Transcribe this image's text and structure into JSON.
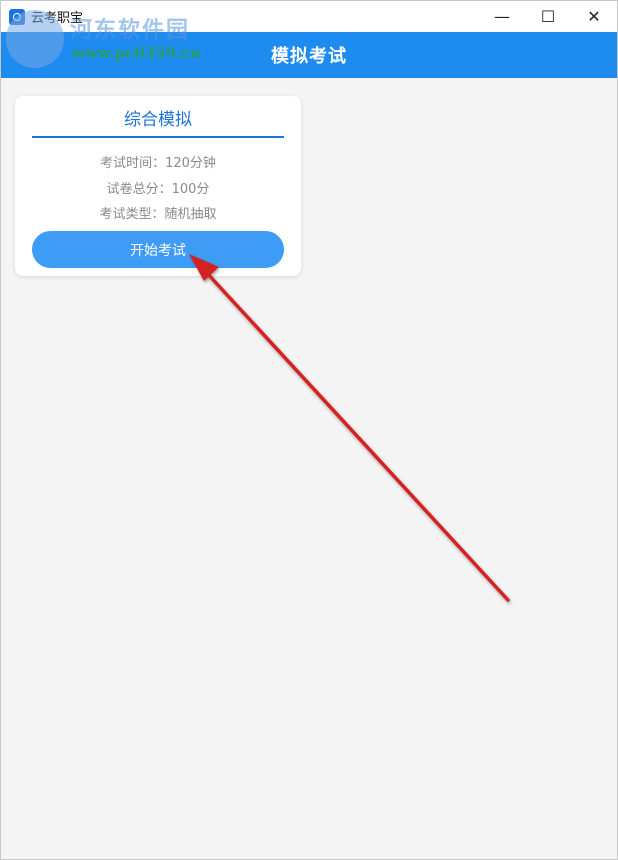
{
  "window": {
    "title": "云考职宝",
    "controls": {
      "minimize": "—",
      "maximize": "☐",
      "close": "✕"
    }
  },
  "watermark": {
    "line1": "河东软件园",
    "line2": "www.pc0359.cn"
  },
  "header": {
    "title": "模拟考试"
  },
  "card": {
    "title": "综合模拟",
    "exam_time": "考试时间：120分钟",
    "total_score": "试卷总分：100分",
    "exam_type": "考试类型：随机抽取",
    "start_button": "开始考试"
  },
  "colors": {
    "accent": "#1e8bf1",
    "button": "#3e9bf6",
    "arrow": "#d42020"
  }
}
